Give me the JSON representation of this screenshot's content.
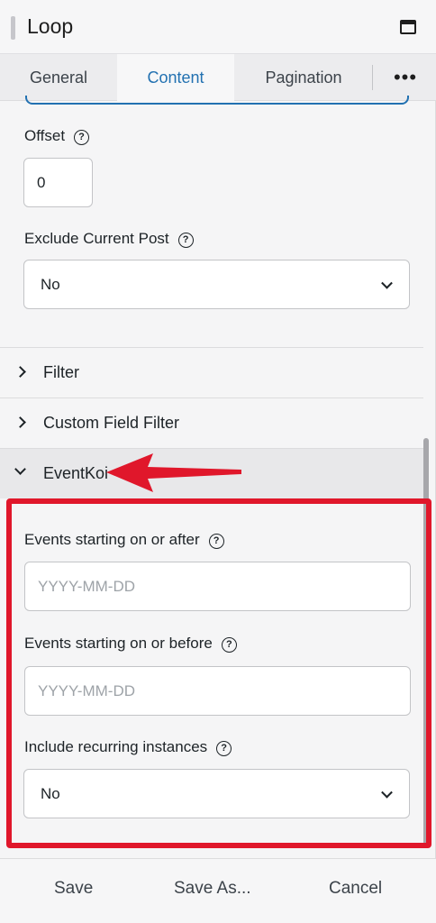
{
  "header": {
    "title": "Loop",
    "window_icon": "window-icon"
  },
  "tabs": [
    {
      "label": "General"
    },
    {
      "label": "Content"
    },
    {
      "label": "Pagination"
    },
    {
      "label": "•••"
    }
  ],
  "offset": {
    "label": "Offset",
    "help": "?",
    "value": "0"
  },
  "exclude_current_post": {
    "label": "Exclude Current Post",
    "help": "?",
    "value": "No"
  },
  "sections": [
    {
      "label": "Filter",
      "expanded": false
    },
    {
      "label": "Custom Field Filter",
      "expanded": false
    },
    {
      "label": "EventKoi",
      "expanded": true
    }
  ],
  "eventkoi": {
    "start_after": {
      "label": "Events starting on or after",
      "help": "?",
      "placeholder": "YYYY-MM-DD"
    },
    "start_before": {
      "label": "Events starting on or before",
      "help": "?",
      "placeholder": "YYYY-MM-DD"
    },
    "recurring": {
      "label": "Include recurring instances",
      "help": "?",
      "value": "No"
    }
  },
  "footer": {
    "save": "Save",
    "save_as": "Save As...",
    "cancel": "Cancel"
  },
  "colors": {
    "accent": "#2271b1",
    "annotation": "#e0172b"
  }
}
